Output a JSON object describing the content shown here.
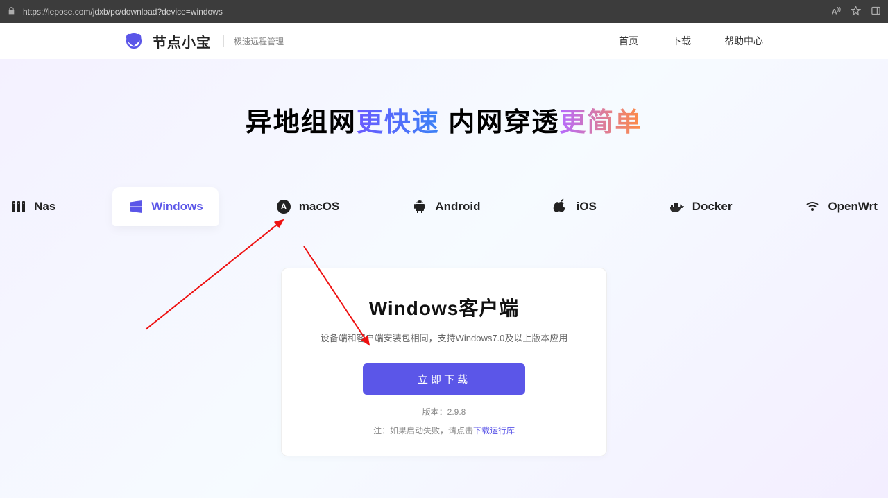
{
  "browser": {
    "url": "https://iepose.com/jdxb/pc/download?device=windows"
  },
  "header": {
    "brand": "节点小宝",
    "tagline": "极速远程管理",
    "nav": {
      "home": "首页",
      "download": "下载",
      "help": "帮助中心"
    }
  },
  "hero": {
    "part1": "异地组网",
    "accent1": "更快速",
    "part2": "  内网穿透",
    "accent2": "更简单"
  },
  "tabs": {
    "nas": "Nas",
    "windows": "Windows",
    "macos": "macOS",
    "android": "Android",
    "ios": "iOS",
    "docker": "Docker",
    "openwrt": "OpenWrt",
    "active": "windows"
  },
  "card": {
    "title": "Windows客户端",
    "desc": "设备端和客户端安装包相同，支持Windows7.0及以上版本应用",
    "button": "立即下载",
    "version_label": "版本：",
    "version": "2.9.8",
    "note_prefix": "注：如果启动失败，请点击",
    "note_link": "下载运行库"
  }
}
